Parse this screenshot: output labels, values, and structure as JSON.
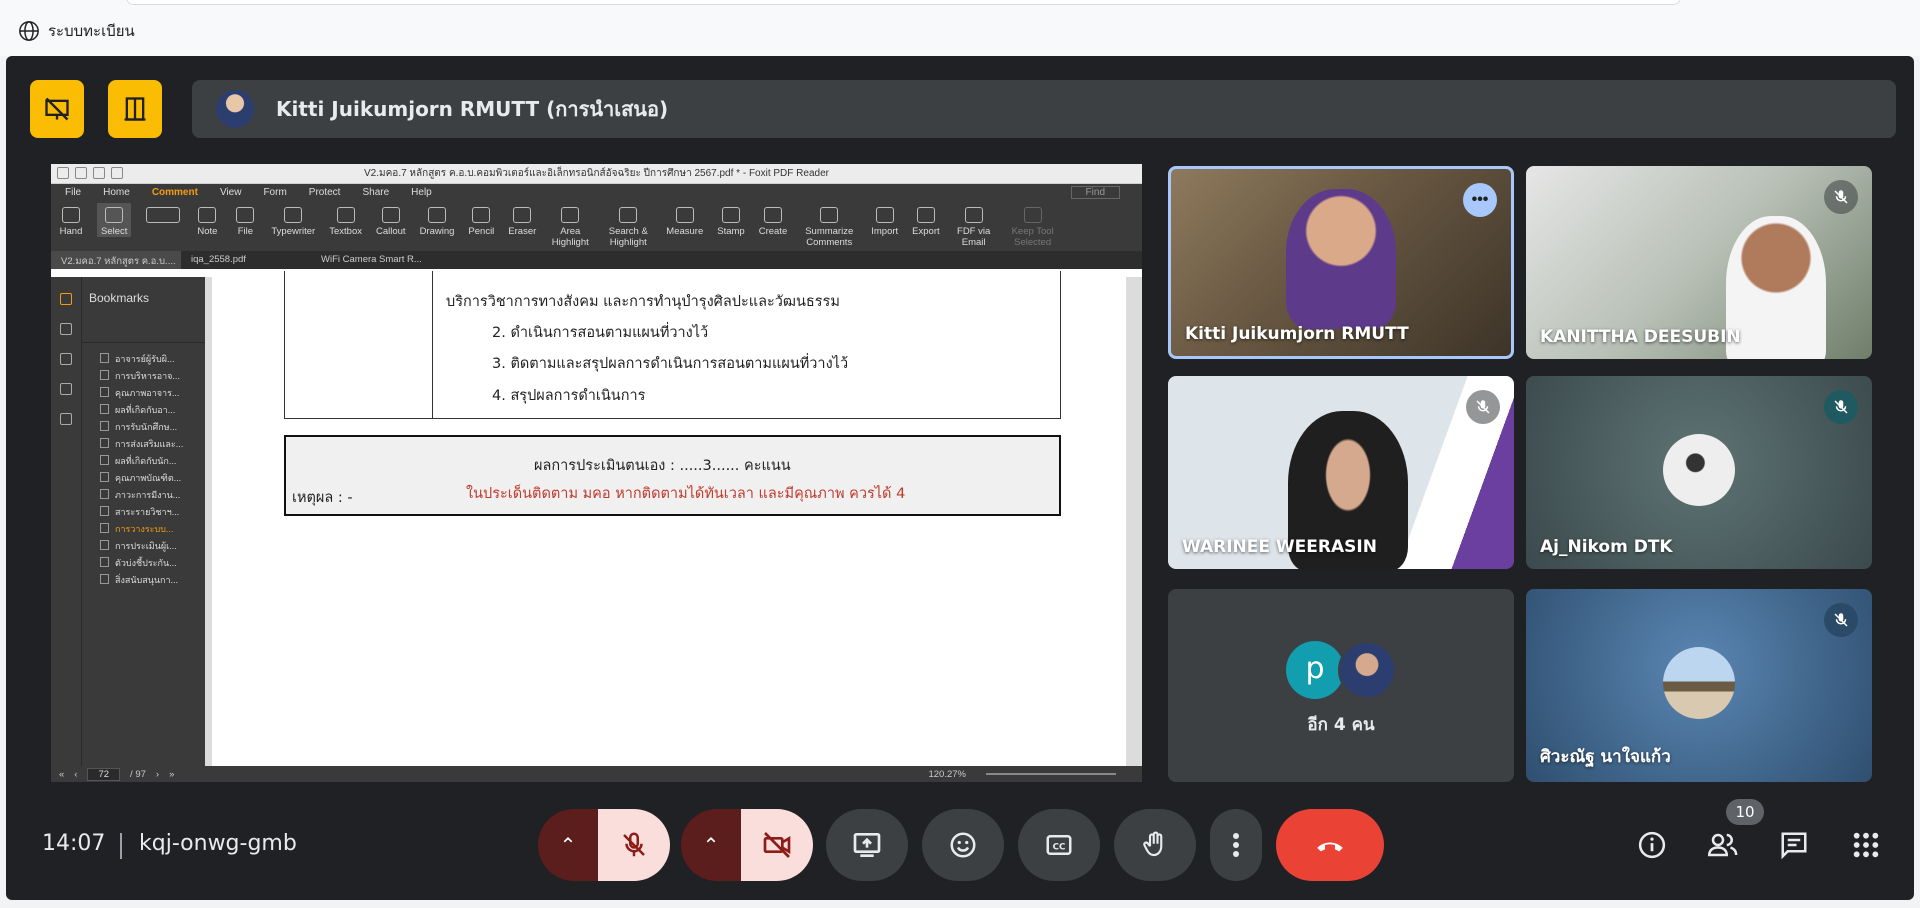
{
  "browser": {
    "site_label": "ระบบทะเบียน"
  },
  "presenter": {
    "title": "Kitti Juikumjorn RMUTT (การนำเสนอ)"
  },
  "pdf": {
    "window_title": "V2.มคอ.7 หลักสูตร ค.อ.บ.คอมพิวเตอร์และอิเล็กทรอนิกส์อัจฉริยะ ปีการศึกษา 2567.pdf * - Foxit PDF Reader",
    "menu": [
      "File",
      "Home",
      "Comment",
      "View",
      "Form",
      "Protect",
      "Share",
      "Help"
    ],
    "active_menu": "Comment",
    "find_placeholder": "Find",
    "tools": [
      "Hand",
      "Select",
      "Note",
      "File",
      "Typewriter",
      "Textbox",
      "Callout",
      "Drawing",
      "Pencil",
      "Eraser",
      "Area Highlight",
      "Search & Highlight",
      "Measure",
      "Stamp",
      "Create",
      "Summarize Comments",
      "Import",
      "Export",
      "FDF via Email",
      "Keep Tool Selected"
    ],
    "tabs": [
      "V2.มคอ.7 หลักสูตร ค.อ.บ....",
      "iqa_2558.pdf",
      "WiFi Camera Smart R..."
    ],
    "bookmarks_title": "Bookmarks",
    "bookmarks": [
      "อาจารย์ผู้รับผิ...",
      "การบริหารอาจ...",
      "คุณภาพอาจาร...",
      "ผลที่เกิดกับอา...",
      "การรับนักศึกษ...",
      "การส่งเสริมและ...",
      "ผลที่เกิดกับนัก...",
      "คุณภาพบัณฑิต...",
      "ภาวะการมีงาน...",
      "สาระรายวิชาฯ...",
      "การวางระบบ...",
      "การประเมินผู้เ...",
      "ตัวบ่งชี้ประกัน...",
      "สิ่งสนับสนุนกา..."
    ],
    "current_bookmark_index": 10,
    "doc_lines": [
      "บริการวิชาการทางสังคม และการทำนุบำรุงศิลปะและวัฒนธรรม",
      "2. ดำเนินการสอนตามแผนที่วางไว้",
      "3. ติดตามและสรุปผลการดำเนินการสอนตามแผนที่วางไว้",
      "4. สรุปผลการดำเนินการ"
    ],
    "score_line": "ผลการประเมินตนเอง  :  .....3...... คะแนน",
    "reason_label": "เหตุผล : -",
    "reason_text": "ในประเด็นติดตาม มคอ หากติดตามได้ทันเวลา และมีคุณภาพ ควรได้ 4",
    "page_current": "72",
    "page_total": "/ 97",
    "zoom": "120.27%"
  },
  "participants": [
    {
      "name": "Kitti Juikumjorn RMUTT",
      "speaking": true
    },
    {
      "name": "KANITTHA DEESUBIN",
      "muted": true
    },
    {
      "name": "WARINEE WEERASIN",
      "muted": true
    },
    {
      "name": "Aj_Nikom DTK",
      "muted": true
    },
    {
      "name": "ศิวะณัฐ นาใจแก้ว",
      "muted": true
    }
  ],
  "others_tile": {
    "initial": "p",
    "label": "อีก 4 คน"
  },
  "meeting": {
    "time": "14:07",
    "code": "kqj-onwg-gmb",
    "people_count": "10"
  },
  "colors": {
    "accent_yellow": "#fbbc04",
    "end_call": "#ea4335",
    "speaking_border": "#a8c7fa",
    "muted_red": "#f9dedc"
  }
}
